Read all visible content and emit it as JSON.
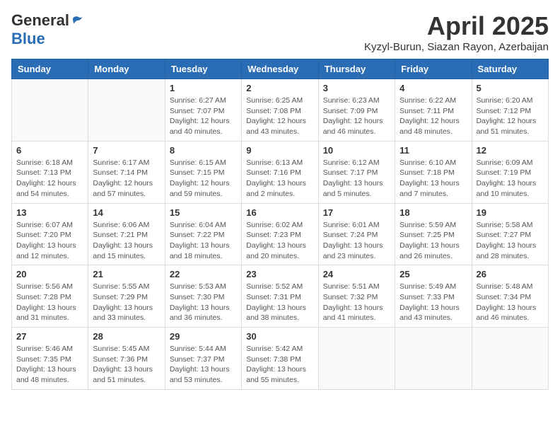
{
  "logo": {
    "general": "General",
    "blue": "Blue"
  },
  "title": "April 2025",
  "location": "Kyzyl-Burun, Siazan Rayon, Azerbaijan",
  "days_of_week": [
    "Sunday",
    "Monday",
    "Tuesday",
    "Wednesday",
    "Thursday",
    "Friday",
    "Saturday"
  ],
  "weeks": [
    [
      {
        "day": "",
        "info": ""
      },
      {
        "day": "",
        "info": ""
      },
      {
        "day": "1",
        "info": "Sunrise: 6:27 AM\nSunset: 7:07 PM\nDaylight: 12 hours and 40 minutes."
      },
      {
        "day": "2",
        "info": "Sunrise: 6:25 AM\nSunset: 7:08 PM\nDaylight: 12 hours and 43 minutes."
      },
      {
        "day": "3",
        "info": "Sunrise: 6:23 AM\nSunset: 7:09 PM\nDaylight: 12 hours and 46 minutes."
      },
      {
        "day": "4",
        "info": "Sunrise: 6:22 AM\nSunset: 7:11 PM\nDaylight: 12 hours and 48 minutes."
      },
      {
        "day": "5",
        "info": "Sunrise: 6:20 AM\nSunset: 7:12 PM\nDaylight: 12 hours and 51 minutes."
      }
    ],
    [
      {
        "day": "6",
        "info": "Sunrise: 6:18 AM\nSunset: 7:13 PM\nDaylight: 12 hours and 54 minutes."
      },
      {
        "day": "7",
        "info": "Sunrise: 6:17 AM\nSunset: 7:14 PM\nDaylight: 12 hours and 57 minutes."
      },
      {
        "day": "8",
        "info": "Sunrise: 6:15 AM\nSunset: 7:15 PM\nDaylight: 12 hours and 59 minutes."
      },
      {
        "day": "9",
        "info": "Sunrise: 6:13 AM\nSunset: 7:16 PM\nDaylight: 13 hours and 2 minutes."
      },
      {
        "day": "10",
        "info": "Sunrise: 6:12 AM\nSunset: 7:17 PM\nDaylight: 13 hours and 5 minutes."
      },
      {
        "day": "11",
        "info": "Sunrise: 6:10 AM\nSunset: 7:18 PM\nDaylight: 13 hours and 7 minutes."
      },
      {
        "day": "12",
        "info": "Sunrise: 6:09 AM\nSunset: 7:19 PM\nDaylight: 13 hours and 10 minutes."
      }
    ],
    [
      {
        "day": "13",
        "info": "Sunrise: 6:07 AM\nSunset: 7:20 PM\nDaylight: 13 hours and 12 minutes."
      },
      {
        "day": "14",
        "info": "Sunrise: 6:06 AM\nSunset: 7:21 PM\nDaylight: 13 hours and 15 minutes."
      },
      {
        "day": "15",
        "info": "Sunrise: 6:04 AM\nSunset: 7:22 PM\nDaylight: 13 hours and 18 minutes."
      },
      {
        "day": "16",
        "info": "Sunrise: 6:02 AM\nSunset: 7:23 PM\nDaylight: 13 hours and 20 minutes."
      },
      {
        "day": "17",
        "info": "Sunrise: 6:01 AM\nSunset: 7:24 PM\nDaylight: 13 hours and 23 minutes."
      },
      {
        "day": "18",
        "info": "Sunrise: 5:59 AM\nSunset: 7:25 PM\nDaylight: 13 hours and 26 minutes."
      },
      {
        "day": "19",
        "info": "Sunrise: 5:58 AM\nSunset: 7:27 PM\nDaylight: 13 hours and 28 minutes."
      }
    ],
    [
      {
        "day": "20",
        "info": "Sunrise: 5:56 AM\nSunset: 7:28 PM\nDaylight: 13 hours and 31 minutes."
      },
      {
        "day": "21",
        "info": "Sunrise: 5:55 AM\nSunset: 7:29 PM\nDaylight: 13 hours and 33 minutes."
      },
      {
        "day": "22",
        "info": "Sunrise: 5:53 AM\nSunset: 7:30 PM\nDaylight: 13 hours and 36 minutes."
      },
      {
        "day": "23",
        "info": "Sunrise: 5:52 AM\nSunset: 7:31 PM\nDaylight: 13 hours and 38 minutes."
      },
      {
        "day": "24",
        "info": "Sunrise: 5:51 AM\nSunset: 7:32 PM\nDaylight: 13 hours and 41 minutes."
      },
      {
        "day": "25",
        "info": "Sunrise: 5:49 AM\nSunset: 7:33 PM\nDaylight: 13 hours and 43 minutes."
      },
      {
        "day": "26",
        "info": "Sunrise: 5:48 AM\nSunset: 7:34 PM\nDaylight: 13 hours and 46 minutes."
      }
    ],
    [
      {
        "day": "27",
        "info": "Sunrise: 5:46 AM\nSunset: 7:35 PM\nDaylight: 13 hours and 48 minutes."
      },
      {
        "day": "28",
        "info": "Sunrise: 5:45 AM\nSunset: 7:36 PM\nDaylight: 13 hours and 51 minutes."
      },
      {
        "day": "29",
        "info": "Sunrise: 5:44 AM\nSunset: 7:37 PM\nDaylight: 13 hours and 53 minutes."
      },
      {
        "day": "30",
        "info": "Sunrise: 5:42 AM\nSunset: 7:38 PM\nDaylight: 13 hours and 55 minutes."
      },
      {
        "day": "",
        "info": ""
      },
      {
        "day": "",
        "info": ""
      },
      {
        "day": "",
        "info": ""
      }
    ]
  ]
}
